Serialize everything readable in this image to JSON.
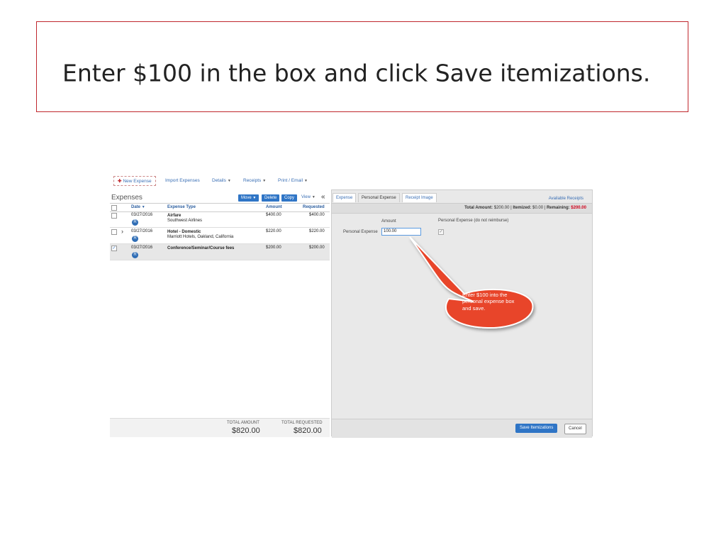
{
  "instruction": {
    "text": "Enter $100 in the box and click Save itemizations."
  },
  "toolbar": {
    "new_expense": "New Expense",
    "import_expenses": "Import Expenses",
    "details": "Details",
    "receipts": "Receipts",
    "print_email": "Print / Email"
  },
  "expenses": {
    "title": "Expenses",
    "move": "Move",
    "delete": "Delete",
    "copy": "Copy",
    "view": "View",
    "collapse": "«",
    "headers": {
      "date": "Date",
      "type": "Expense Type",
      "amount": "Amount",
      "requested": "Requested"
    },
    "rows": [
      {
        "date": "03/27/2016",
        "type": "Airfare",
        "sub": "Southwest Airlines",
        "amount": "$400.00",
        "requested": "$400.00"
      },
      {
        "date": "03/27/2016",
        "type": "Hotel - Domestic",
        "sub": "Marriott Hotels, Oakland, California",
        "amount": "$220.00",
        "requested": "$220.00"
      },
      {
        "date": "03/27/2016",
        "type": "Conference/Seminar/Course fees",
        "sub": "",
        "amount": "$200.00",
        "requested": "$200.00"
      }
    ],
    "total_amount_label": "TOTAL AMOUNT",
    "total_amount": "$820.00",
    "total_requested_label": "TOTAL REQUESTED",
    "total_requested": "$820.00"
  },
  "detail": {
    "tabs": [
      "Expense",
      "Personal Expense",
      "Receipt Image"
    ],
    "available_receipts": "Available Receipts",
    "summary": {
      "total_label": "Total Amount:",
      "total_value": "$200.00",
      "itemized_label": "Itemized:",
      "itemized_value": "$0.00",
      "remaining_label": "Remaining:",
      "remaining_value": "$200.00"
    },
    "amount_header": "Amount",
    "personal_header": "Personal Expense (do not reimburse)",
    "field_label": "Personal Expense",
    "field_value": "100.00",
    "save_button": "Save Itemizations",
    "cancel_button": "Cancel"
  },
  "callout": {
    "text": "Enter $100 into the personal expense box and save."
  },
  "colors": {
    "accent": "#2f75c6",
    "callout": "#e8452c",
    "frame": "#c0272d"
  }
}
